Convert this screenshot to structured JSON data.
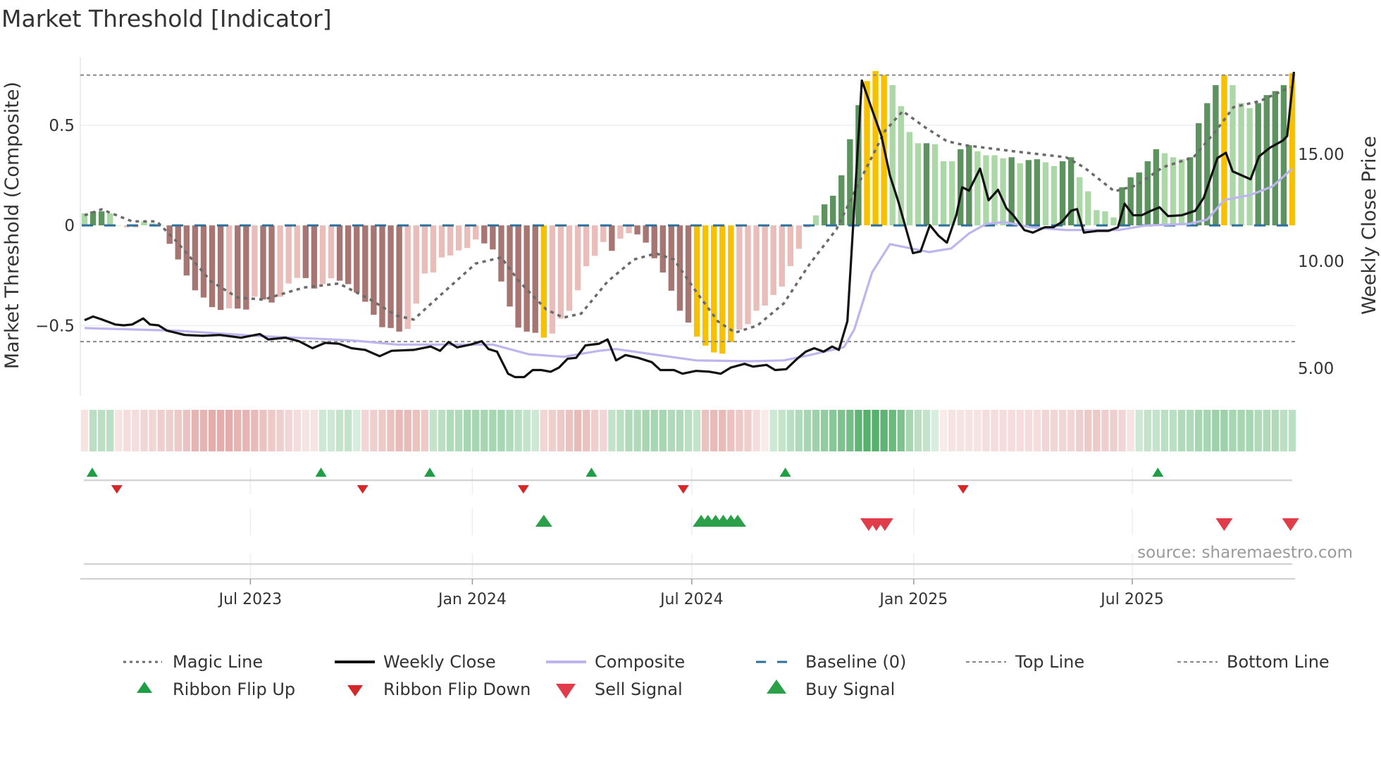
{
  "title": "Market Threshold [Indicator]",
  "source": "source: sharemaestro.com",
  "colors": {
    "bar_pos_dark": "#5d935f",
    "bar_pos_light": "#acd8a8",
    "bar_neg_dark": "#a87672",
    "bar_neg_light": "#e9bdb9",
    "bar_signal": "#f7c000",
    "ribbon_pos": "#2e9e4a",
    "ribbon_neg": "#cf706b",
    "magic_line": "#6b6b6b",
    "weekly_close": "#111111",
    "composite": "#bdb6ee",
    "baseline": "#2b6f9a",
    "threshold_lines": "#888888",
    "flip_up": "#1f9e45",
    "flip_down": "#d62728",
    "buy": "#2ca048",
    "sell": "#e03c4a"
  },
  "chart_data": {
    "type": "bar",
    "title": "Market Threshold [Indicator]",
    "ylabel_left": "Market Threshold (Composite)",
    "ylabel_right": "Weekly Close Price",
    "x_unit": "week index (weekly bars, ~Feb 2023 to Nov 2025)",
    "ylim_left": [
      -0.85,
      0.84
    ],
    "ylim_right": [
      3.72,
      19.54
    ],
    "xlim": [
      -0.5,
      143
    ],
    "grid": true,
    "yticks_left": [
      {
        "value": 0.5,
        "label": "0.5"
      },
      {
        "value": 0,
        "label": "0"
      },
      {
        "value": -0.5,
        "label": "−0.5"
      }
    ],
    "yticks_right": [
      {
        "value": 15,
        "label": "15.00"
      },
      {
        "value": 10,
        "label": "10.00"
      },
      {
        "value": 5,
        "label": "5.00"
      }
    ],
    "xticks": [
      {
        "week": 19.5,
        "label": "Jul 2023"
      },
      {
        "week": 45.6,
        "label": "Jan 2024"
      },
      {
        "week": 71.4,
        "label": "Jul 2024"
      },
      {
        "week": 97.5,
        "label": "Jan 2025"
      },
      {
        "week": 123.2,
        "label": "Jul 2025"
      }
    ],
    "top_line": 0.75,
    "bottom_line": -0.58,
    "baseline": 0,
    "composite_bars": {
      "values": [
        0.06,
        0.07,
        0.07,
        0.06,
        0,
        -0.01,
        -0.01,
        0.02,
        0.01,
        0,
        -0.092,
        -0.17,
        -0.25,
        -0.324,
        -0.36,
        -0.408,
        -0.422,
        -0.414,
        -0.415,
        -0.42,
        -0.356,
        -0.37,
        -0.385,
        -0.356,
        -0.29,
        -0.262,
        -0.263,
        -0.315,
        -0.293,
        -0.264,
        -0.276,
        -0.293,
        -0.335,
        -0.381,
        -0.446,
        -0.508,
        -0.512,
        -0.53,
        -0.517,
        -0.39,
        -0.24,
        -0.235,
        -0.16,
        -0.15,
        -0.125,
        -0.113,
        -0.07,
        -0.09,
        -0.12,
        -0.28,
        -0.405,
        -0.51,
        -0.53,
        -0.536,
        -0.56,
        -0.54,
        -0.465,
        -0.426,
        -0.324,
        -0.204,
        -0.152,
        -0.083,
        -0.127,
        -0.066,
        -0.039,
        -0.045,
        -0.086,
        -0.164,
        -0.235,
        -0.326,
        -0.426,
        -0.485,
        -0.555,
        -0.6,
        -0.634,
        -0.64,
        -0.582,
        -0.52,
        -0.493,
        -0.426,
        -0.4,
        -0.347,
        -0.305,
        -0.203,
        -0.117,
        -0.01,
        0.05,
        0.105,
        0.148,
        0.25,
        0.43,
        0.6,
        0.72,
        0.77,
        0.75,
        0.7,
        0.595,
        0.466,
        0.41,
        0.41,
        0.405,
        0.32,
        0.32,
        0.38,
        0.4,
        0.37,
        0.35,
        0.35,
        0.335,
        0.34,
        0.31,
        0.326,
        0.33,
        0.315,
        0.296,
        0.32,
        0.34,
        0.24,
        0.17,
        0.076,
        0.07,
        0.04,
        0.19,
        0.24,
        0.264,
        0.32,
        0.38,
        0.36,
        0.34,
        0.33,
        0.34,
        0.51,
        0.61,
        0.7,
        0.75,
        0.7,
        0.61,
        0.585,
        0.61,
        0.65,
        0.67,
        0.7,
        0.76
      ],
      "styles": "lddlllllll dddddddlddlddllldd ll dddddddd l lllllllldd dddddy lllllll d ll ddddddd yyyyy llllllll l ldddddyyyllll d lll dd llll d l dd ll dd lllll ddddd lll dddd y lll dddd y",
      "style_key": {
        "d": "strong",
        "l": "weak",
        "y": "signal"
      }
    },
    "magic_line": [
      [
        0,
        0.05
      ],
      [
        2,
        0.08
      ],
      [
        5.6,
        0.02
      ],
      [
        8.5,
        0.02
      ],
      [
        10.8,
        -0.08
      ],
      [
        14.9,
        -0.28
      ],
      [
        18,
        -0.36
      ],
      [
        21,
        -0.37
      ],
      [
        25.8,
        -0.31
      ],
      [
        29.9,
        -0.29
      ],
      [
        33.6,
        -0.37
      ],
      [
        36.7,
        -0.45
      ],
      [
        38.7,
        -0.47
      ],
      [
        41.8,
        -0.35
      ],
      [
        46,
        -0.19
      ],
      [
        49,
        -0.16
      ],
      [
        51.1,
        -0.28
      ],
      [
        54.3,
        -0.42
      ],
      [
        56.3,
        -0.46
      ],
      [
        58.4,
        -0.44
      ],
      [
        61.5,
        -0.28
      ],
      [
        64.6,
        -0.17
      ],
      [
        67.2,
        -0.14
      ],
      [
        69.3,
        -0.17
      ],
      [
        71.9,
        -0.33
      ],
      [
        74.5,
        -0.48
      ],
      [
        76.5,
        -0.535
      ],
      [
        79.1,
        -0.5
      ],
      [
        82.2,
        -0.39
      ],
      [
        85.3,
        -0.19
      ],
      [
        88.4,
        -0.02
      ],
      [
        91.5,
        0.25
      ],
      [
        94.1,
        0.47
      ],
      [
        96.2,
        0.57
      ],
      [
        98.8,
        0.49
      ],
      [
        101.4,
        0.42
      ],
      [
        103.5,
        0.4
      ],
      [
        109.2,
        0.37
      ],
      [
        115.4,
        0.34
      ],
      [
        117.5,
        0.29
      ],
      [
        121.1,
        0.17
      ],
      [
        123.7,
        0.2
      ],
      [
        126.8,
        0.29
      ],
      [
        130.4,
        0.34
      ],
      [
        133,
        0.47
      ],
      [
        135.1,
        0.59
      ],
      [
        138.2,
        0.62
      ],
      [
        141.8,
        0.69
      ]
    ],
    "composite_line": [
      [
        0,
        6.88
      ],
      [
        10.8,
        6.76
      ],
      [
        20,
        6.52
      ],
      [
        31.4,
        6.31
      ],
      [
        36.7,
        6.11
      ],
      [
        48,
        6.11
      ],
      [
        52.2,
        5.66
      ],
      [
        56.3,
        5.54
      ],
      [
        60.5,
        5.82
      ],
      [
        62.5,
        5.9
      ],
      [
        66.7,
        5.66
      ],
      [
        71.9,
        5.37
      ],
      [
        78.1,
        5.33
      ],
      [
        82.2,
        5.37
      ],
      [
        85.3,
        5.62
      ],
      [
        89.3,
        5.99
      ],
      [
        90.5,
        6.81
      ],
      [
        92.6,
        9.48
      ],
      [
        94.7,
        10.8
      ],
      [
        96.7,
        10.64
      ],
      [
        99.3,
        10.43
      ],
      [
        101.9,
        10.6
      ],
      [
        104,
        11.3
      ],
      [
        106,
        11.75
      ],
      [
        108.2,
        11.83
      ],
      [
        111.2,
        11.59
      ],
      [
        115.4,
        11.46
      ],
      [
        118.5,
        11.46
      ],
      [
        121.6,
        11.46
      ],
      [
        124.7,
        11.67
      ],
      [
        129.9,
        11.75
      ],
      [
        132,
        11.95
      ],
      [
        134,
        12.86
      ],
      [
        137.1,
        13.1
      ],
      [
        139.7,
        13.5
      ],
      [
        142,
        14.33
      ]
    ],
    "weekly_close": [
      [
        0,
        7.25
      ],
      [
        1,
        7.42
      ],
      [
        2,
        7.29
      ],
      [
        3.6,
        7.05
      ],
      [
        4.6,
        7.01
      ],
      [
        5.6,
        7.05
      ],
      [
        6.9,
        7.33
      ],
      [
        7.7,
        7.05
      ],
      [
        8.7,
        7.01
      ],
      [
        9.7,
        6.76
      ],
      [
        11.8,
        6.56
      ],
      [
        13.9,
        6.52
      ],
      [
        15.9,
        6.56
      ],
      [
        18.4,
        6.43
      ],
      [
        20.6,
        6.6
      ],
      [
        21.6,
        6.35
      ],
      [
        23.6,
        6.43
      ],
      [
        25.2,
        6.27
      ],
      [
        26.8,
        5.94
      ],
      [
        28.3,
        6.19
      ],
      [
        29.9,
        6.15
      ],
      [
        31.4,
        5.94
      ],
      [
        33,
        5.86
      ],
      [
        34.7,
        5.57
      ],
      [
        36.1,
        5.82
      ],
      [
        38.7,
        5.86
      ],
      [
        40.7,
        6.02
      ],
      [
        41.8,
        5.82
      ],
      [
        42.8,
        6.23
      ],
      [
        43.8,
        5.98
      ],
      [
        45.4,
        6.11
      ],
      [
        46.7,
        6.27
      ],
      [
        47.5,
        5.9
      ],
      [
        48.5,
        5.78
      ],
      [
        49.8,
        4.75
      ],
      [
        50.6,
        4.59
      ],
      [
        51.7,
        4.59
      ],
      [
        52.7,
        4.92
      ],
      [
        53.7,
        4.92
      ],
      [
        54.8,
        4.84
      ],
      [
        55.8,
        5.04
      ],
      [
        56.8,
        5.45
      ],
      [
        57.8,
        5.49
      ],
      [
        58.9,
        6.07
      ],
      [
        60.5,
        6.15
      ],
      [
        61.5,
        6.35
      ],
      [
        62.5,
        5.37
      ],
      [
        63.6,
        5.62
      ],
      [
        65.1,
        5.49
      ],
      [
        66.7,
        5.29
      ],
      [
        67.7,
        4.92
      ],
      [
        69.3,
        4.92
      ],
      [
        70.3,
        4.75
      ],
      [
        71.9,
        4.88
      ],
      [
        73.5,
        4.84
      ],
      [
        74.8,
        4.75
      ],
      [
        76,
        5.04
      ],
      [
        77.6,
        5.21
      ],
      [
        78.6,
        5.08
      ],
      [
        80.2,
        5.16
      ],
      [
        81.2,
        4.92
      ],
      [
        82.5,
        4.96
      ],
      [
        83.8,
        5.45
      ],
      [
        84.8,
        5.78
      ],
      [
        85.8,
        5.94
      ],
      [
        86.9,
        5.78
      ],
      [
        87.9,
        6.02
      ],
      [
        88.7,
        5.86
      ],
      [
        89.7,
        7.21
      ],
      [
        91.4,
        18.44
      ],
      [
        92.6,
        17.08
      ],
      [
        93.7,
        15.85
      ],
      [
        94.7,
        14.0
      ],
      [
        95.7,
        12.77
      ],
      [
        97.4,
        10.38
      ],
      [
        98.3,
        10.46
      ],
      [
        99.4,
        11.69
      ],
      [
        100.4,
        11.2
      ],
      [
        101.4,
        10.87
      ],
      [
        102.5,
        12.15
      ],
      [
        103.2,
        13.46
      ],
      [
        104,
        13.3
      ],
      [
        105.3,
        14.33
      ],
      [
        106.3,
        12.85
      ],
      [
        107.4,
        13.34
      ],
      [
        108.4,
        12.48
      ],
      [
        109.2,
        12.15
      ],
      [
        110.5,
        11.46
      ],
      [
        111.5,
        11.34
      ],
      [
        112.9,
        11.59
      ],
      [
        113.9,
        11.59
      ],
      [
        114.9,
        11.83
      ],
      [
        116,
        12.36
      ],
      [
        116.7,
        12.44
      ],
      [
        117.5,
        11.34
      ],
      [
        119.1,
        11.42
      ],
      [
        120.4,
        11.42
      ],
      [
        121.5,
        11.59
      ],
      [
        122.3,
        12.69
      ],
      [
        123.3,
        12.15
      ],
      [
        124.3,
        12.15
      ],
      [
        125.4,
        12.36
      ],
      [
        126.4,
        12.52
      ],
      [
        127.4,
        12.11
      ],
      [
        129,
        12.15
      ],
      [
        130.6,
        12.36
      ],
      [
        131.6,
        12.97
      ],
      [
        133.2,
        14.82
      ],
      [
        134.2,
        15.07
      ],
      [
        135,
        14.2
      ],
      [
        137.1,
        13.83
      ],
      [
        138.1,
        14.9
      ],
      [
        139.4,
        15.31
      ],
      [
        140.9,
        15.64
      ],
      [
        141.4,
        15.85
      ],
      [
        142.2,
        18.85
      ]
    ],
    "ribbon": [
      -0.2,
      0.35,
      0.35,
      0.35,
      -0.2,
      -0.25,
      -0.25,
      -0.3,
      -0.3,
      -0.35,
      -0.35,
      -0.4,
      -0.45,
      -0.55,
      -0.55,
      -0.6,
      -0.6,
      -0.6,
      -0.55,
      -0.55,
      -0.5,
      -0.45,
      -0.4,
      -0.35,
      -0.3,
      -0.25,
      -0.2,
      -0.2,
      0.25,
      0.25,
      0.3,
      0.3,
      0.2,
      -0.3,
      -0.35,
      -0.4,
      -0.45,
      -0.5,
      -0.5,
      -0.45,
      -0.4,
      0.3,
      0.35,
      0.4,
      0.4,
      0.45,
      0.45,
      0.45,
      0.45,
      0.45,
      0.4,
      0.35,
      0.3,
      0.25,
      -0.3,
      -0.35,
      -0.4,
      -0.45,
      -0.5,
      -0.45,
      -0.35,
      -0.3,
      0.3,
      0.35,
      0.4,
      0.4,
      0.45,
      0.45,
      0.45,
      0.4,
      0.4,
      0.35,
      0.3,
      -0.45,
      -0.5,
      -0.5,
      -0.45,
      -0.4,
      -0.35,
      -0.25,
      -0.15,
      0.25,
      0.3,
      0.35,
      0.4,
      0.45,
      0.5,
      0.55,
      0.6,
      0.65,
      0.7,
      0.8,
      0.85,
      0.85,
      0.8,
      0.75,
      0.65,
      0.45,
      0.35,
      0.3,
      0.2,
      -0.15,
      -0.2,
      -0.2,
      -0.2,
      -0.2,
      -0.25,
      -0.25,
      -0.25,
      -0.25,
      -0.25,
      -0.25,
      -0.25,
      -0.3,
      -0.3,
      -0.3,
      -0.3,
      -0.35,
      -0.4,
      -0.4,
      -0.35,
      -0.35,
      -0.3,
      -0.2,
      0.25,
      0.3,
      0.3,
      0.35,
      0.35,
      0.4,
      0.4,
      0.45,
      0.45,
      0.5,
      0.5,
      0.45,
      0.45,
      0.45,
      0.4,
      0.4,
      0.4,
      0.35,
      0.35
    ],
    "ribbon_flip_up": [
      0.9,
      27.8,
      40.6,
      59.6,
      82.4,
      126.2
    ],
    "ribbon_flip_down": [
      3.8,
      32.7,
      51.6,
      70.4,
      103.3
    ],
    "buy_signals": [
      54,
      72.5,
      73.3,
      74.2,
      75.1,
      76,
      76.8
    ],
    "sell_signals": [
      92.2,
      93.1,
      94.1,
      134,
      141.8
    ],
    "legend": [
      {
        "label": "Magic Line",
        "type": "dotted-line"
      },
      {
        "label": "Weekly Close",
        "type": "solid-line"
      },
      {
        "label": "Composite",
        "type": "solid-line"
      },
      {
        "label": "Baseline (0)",
        "type": "dashed-line"
      },
      {
        "label": "Top Line",
        "type": "dashed-line"
      },
      {
        "label": "Bottom Line",
        "type": "dashed-line"
      },
      {
        "label": "Ribbon Flip Up",
        "type": "triangle-up"
      },
      {
        "label": "Ribbon Flip Down",
        "type": "triangle-down"
      },
      {
        "label": "Sell Signal",
        "type": "triangle-down"
      },
      {
        "label": "Buy Signal",
        "type": "triangle-up"
      }
    ]
  }
}
